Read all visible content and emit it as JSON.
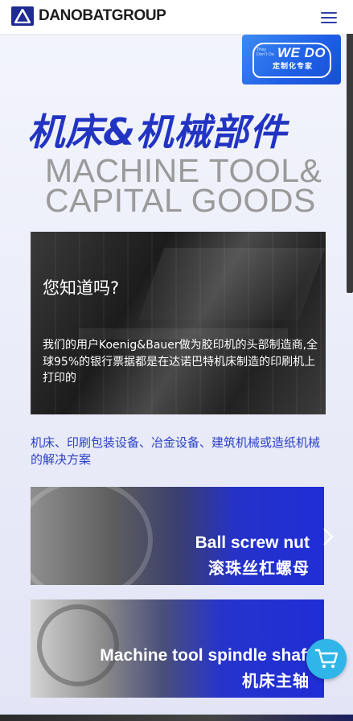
{
  "header": {
    "logo_text": "DANOBATGROUP",
    "menu_icon": "hamburger-menu-icon"
  },
  "badge": {
    "small_text": "They Don't Do",
    "big_text": "WE DO",
    "cn_text": "定制化专家"
  },
  "hero": {
    "title_cn": "机床&机械部件",
    "title_en_line1": "MACHINE TOOL&",
    "title_en_line2": "CAPITAL GOODS"
  },
  "info_card": {
    "heading": "您知道吗?",
    "body": "我们的用户Koenig&Bauer做为胶印机的头部制造商,全球95%的银行票据都是在达诺巴特机床制造的印刷机上打印的"
  },
  "description": "机床、印刷包装设备、冶金设备、建筑机械或造纸机械的解决方案",
  "cards": [
    {
      "en": "Ball screw nut",
      "cn": "滚珠丝杠螺母"
    },
    {
      "en": "Machine tool spindle shaft",
      "cn": "机床主轴"
    }
  ],
  "colors": {
    "brand_blue": "#2234c2",
    "cart_button": "#2fb5e8"
  }
}
